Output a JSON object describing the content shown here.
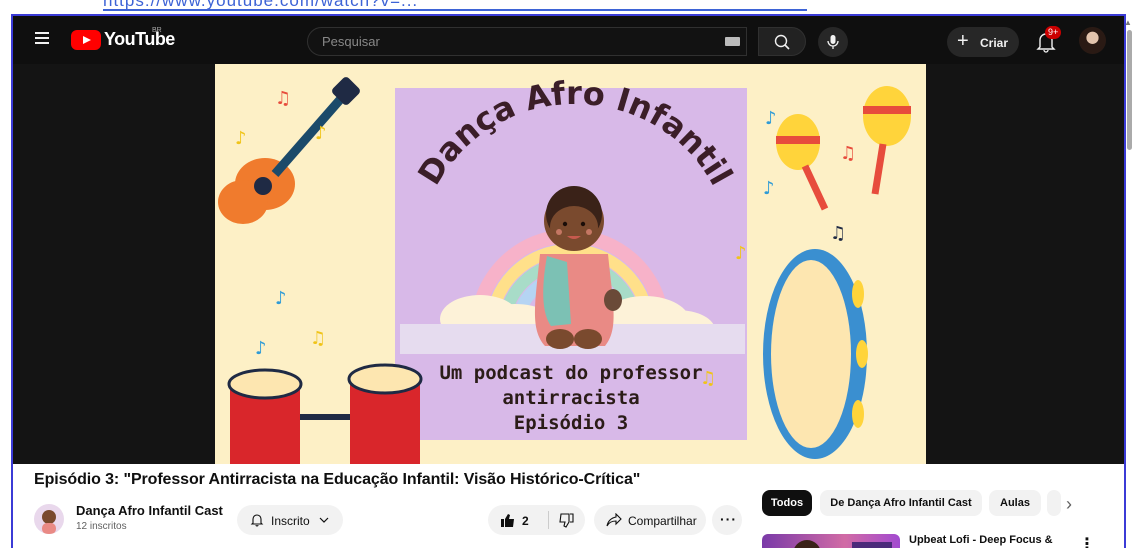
{
  "top_link": {
    "text": "https://www.youtube.com/watch?v=..."
  },
  "masthead": {
    "logo_text": "YouTube",
    "country_code": "BR",
    "search_placeholder": "Pesquisar",
    "create_label": "Criar",
    "notification_count": "9+"
  },
  "thumbnail": {
    "title": "Dança Afro Infantil",
    "subtitle_line1": "Um podcast do professor",
    "subtitle_line2": "antirracista",
    "subtitle_line3": "Episódio 3"
  },
  "video": {
    "title": "Episódio 3: \"Professor Antirracista na Educação Infantil: Visão Histórico-Crítica\"",
    "channel_name": "Dança Afro Infantil Cast",
    "subscribers": "12 inscritos",
    "subscribed_label": "Inscrito",
    "like_count": "2",
    "share_label": "Compartilhar"
  },
  "filter_chips": [
    {
      "label": "Todos",
      "active": true
    },
    {
      "label": "De Dança Afro Infantil Cast",
      "active": false
    },
    {
      "label": "Aulas",
      "active": false
    }
  ],
  "recommendation": {
    "title": "Upbeat Lofi - Deep Focus &"
  },
  "colors": {
    "brand_red": "#ff0000",
    "masthead_bg": "#0f0f0f",
    "thumb_bg": "#fdf0c6",
    "thumb_square": "#d8b9e8"
  },
  "icons": [
    "menu-icon",
    "youtube-logo-icon",
    "keyboard-icon",
    "search-icon",
    "mic-icon",
    "plus-icon",
    "bell-icon",
    "chevron-down-icon",
    "thumbs-up-icon",
    "thumbs-down-icon",
    "share-icon",
    "more-horiz-icon",
    "chevron-right-icon",
    "more-vert-icon"
  ]
}
